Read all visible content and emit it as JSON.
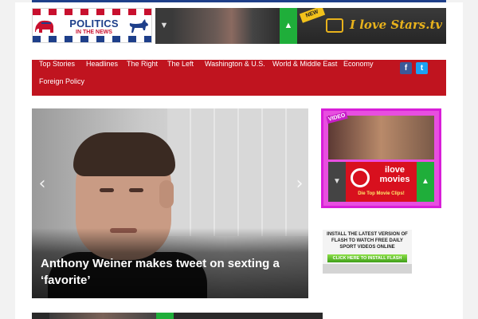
{
  "header": {
    "logo": {
      "line1": "POLITICS",
      "line2": "IN THE NEWS"
    },
    "banner_ad": {
      "tag": "NEW",
      "brand": "I love Stars.tv",
      "thumbs_down_icon": "thumbs-down-icon",
      "thumbs_up_icon": "thumbs-up-icon"
    }
  },
  "nav": {
    "items": [
      {
        "label": "Top Stories"
      },
      {
        "label": "Headlines"
      },
      {
        "label": "The Right"
      },
      {
        "label": "The Left"
      },
      {
        "label": "Washington & U.S."
      },
      {
        "label": "World & Middle East"
      },
      {
        "label": "Economy"
      },
      {
        "label": "Foreign Policy"
      }
    ],
    "social": {
      "facebook": "f",
      "twitter": "t"
    }
  },
  "slider": {
    "headline": "Anthony Weiner makes tweet on sexting a ‘favorite’",
    "prev_arrow": "‹",
    "next_arrow": "›"
  },
  "sidebar": {
    "movies_ad": {
      "tag": "VIDEO",
      "brand": "ilove movies",
      "tagline": "Die Top Movie Clips!"
    },
    "flash_ad": {
      "text": "INSTALL THE LATEST VERSION OF FLASH TO WATCH FREE DAILY SPORT VIDEOS ONLINE",
      "button": "CLICK HERE TO INSTALL FLASH"
    }
  },
  "colors": {
    "nav_bg": "#c0141f",
    "brand_blue": "#1e3f8a",
    "ad_magenta": "#d81ed8",
    "thumb_green": "#1fae3a"
  }
}
